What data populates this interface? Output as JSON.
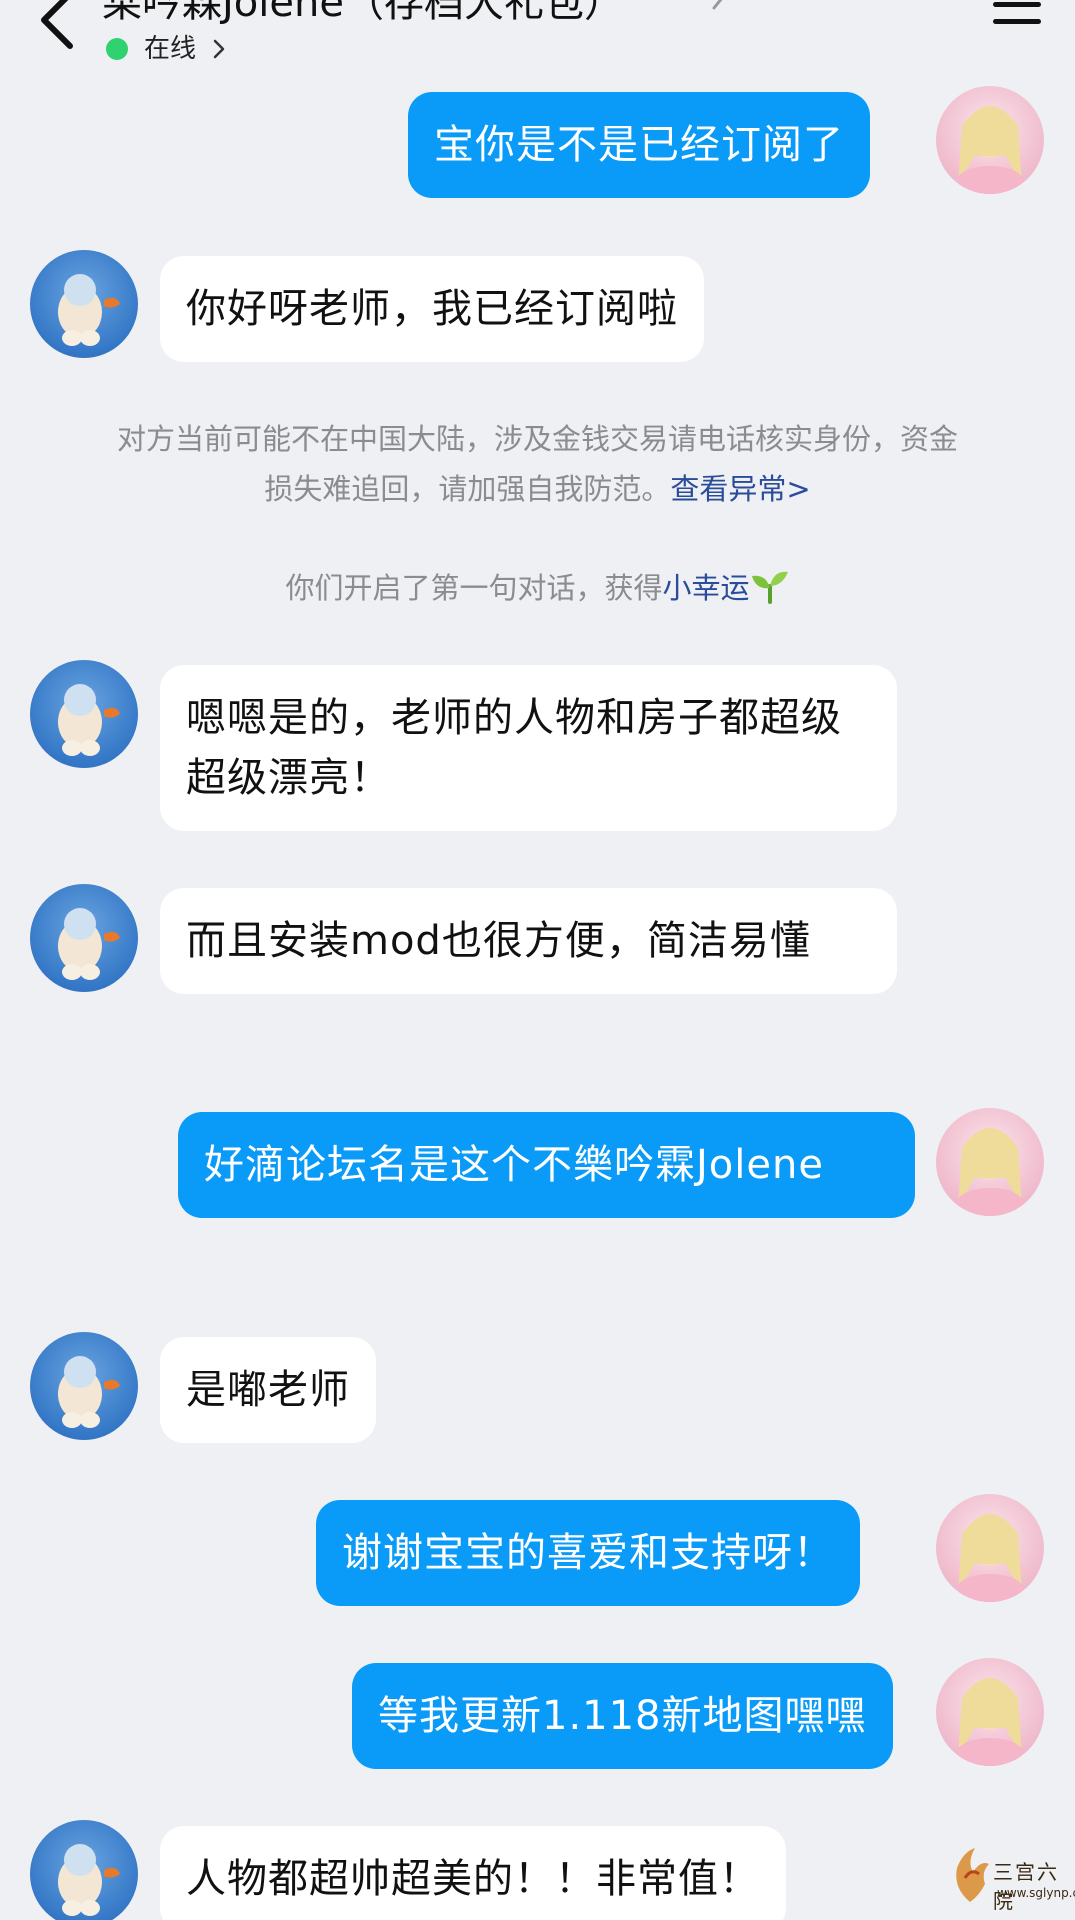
{
  "header": {
    "title": "桒吟森Jolene（存档大礼包）",
    "status": "在线"
  },
  "messages": [
    {
      "side": "me",
      "text": "宝你是不是已经订阅了"
    },
    {
      "side": "peer",
      "text": "你好呀老师，我已经订阅啦"
    },
    {
      "side": "peer",
      "text": "嗯嗯是的，老师的人物和房子都超级超级漂亮！"
    },
    {
      "side": "peer",
      "text": "而且安装mod也很方便，简洁易懂"
    },
    {
      "side": "me",
      "text": "好滴论坛名是这个不樂吟霖Jolene"
    },
    {
      "side": "peer",
      "text": "是嘟老师"
    },
    {
      "side": "me",
      "text": "谢谢宝宝的喜爱和支持呀！"
    },
    {
      "side": "me",
      "text": "等我更新1.118新地图嘿嘿"
    },
    {
      "side": "peer",
      "text": "人物都超帅超美的！！非常值！"
    }
  ],
  "system": {
    "warning_line1": "对方当前可能不在中国大陆，涉及金钱交易请电话核实身份，资金",
    "warning_line2": "损失难追回，请加强自我防范。",
    "warning_link": "查看异常>",
    "first_chat_text": "你们开启了第一句对话，获得",
    "first_chat_link": "小幸运"
  },
  "watermark": {
    "name": "三宫六院",
    "url": "www.sglynp.com"
  },
  "colors": {
    "background": "#eff0f3",
    "my_bubble": "#0a9af7",
    "peer_bubble": "#ffffff",
    "online_dot": "#2fd26e",
    "link": "#2a4c9a"
  },
  "icons": [
    "back-arrow-icon",
    "edit-icon",
    "chevron-right-icon",
    "menu-icon",
    "sprout-icon"
  ]
}
